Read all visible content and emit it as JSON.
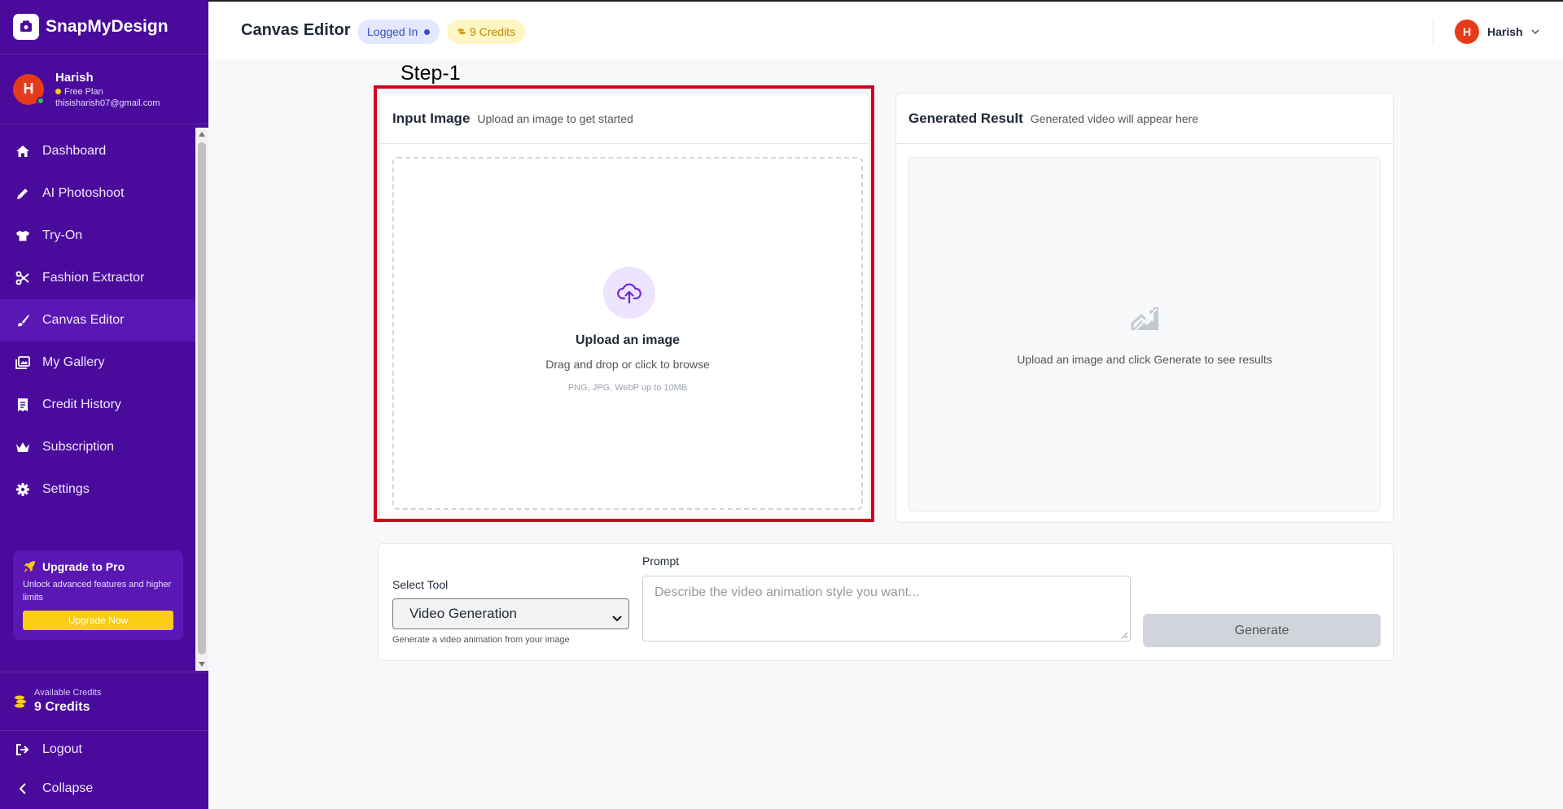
{
  "sidebar": {
    "brand": "SnapMyDesign",
    "user": {
      "initial": "H",
      "name": "Harish",
      "plan": "Free Plan",
      "email": "thisisharish07@gmail.com"
    },
    "items": [
      {
        "label": "Dashboard",
        "icon": "home-icon"
      },
      {
        "label": "AI Photoshoot",
        "icon": "pencil-icon"
      },
      {
        "label": "Try-On",
        "icon": "shirt-icon"
      },
      {
        "label": "Fashion Extractor",
        "icon": "scissors-icon"
      },
      {
        "label": "Canvas Editor",
        "icon": "brush-icon"
      },
      {
        "label": "My Gallery",
        "icon": "gallery-icon"
      },
      {
        "label": "Credit History",
        "icon": "receipt-icon"
      },
      {
        "label": "Subscription",
        "icon": "crown-icon"
      },
      {
        "label": "Settings",
        "icon": "gear-icon"
      }
    ],
    "active_item": "Canvas Editor",
    "upgrade": {
      "title": "Upgrade to Pro",
      "desc": "Unlock advanced features and higher limits",
      "button": "Upgrade Now"
    },
    "credits": {
      "label": "Available Credits",
      "value": "9 Credits"
    },
    "logout": "Logout",
    "collapse": "Collapse"
  },
  "header": {
    "title": "Canvas Editor",
    "status_badge": "Logged In",
    "credits_badge": "9 Credits",
    "user_initial": "H",
    "user_name": "Harish"
  },
  "annotation": {
    "step_label": "Step-1"
  },
  "input_card": {
    "title": "Input Image",
    "subtitle": "Upload an image to get started",
    "upload_title": "Upload an image",
    "upload_sub": "Drag and drop or click to browse",
    "upload_note": "PNG, JPG, WebP up to 10MB"
  },
  "result_card": {
    "title": "Generated Result",
    "subtitle": "Generated video will appear here",
    "empty_text": "Upload an image and click Generate to see results"
  },
  "controls": {
    "tool_label": "Select Tool",
    "tool_value": "Video Generation",
    "tool_help": "Generate a video animation from your image",
    "prompt_label": "Prompt",
    "prompt_placeholder": "Describe the video animation style you want...",
    "generate_button": "Generate"
  },
  "colors": {
    "sidebar_bg": "#4a0a9c",
    "active_bg": "#5b17b4",
    "accent_yellow": "#facc15",
    "annotation_red": "#d0021b"
  }
}
